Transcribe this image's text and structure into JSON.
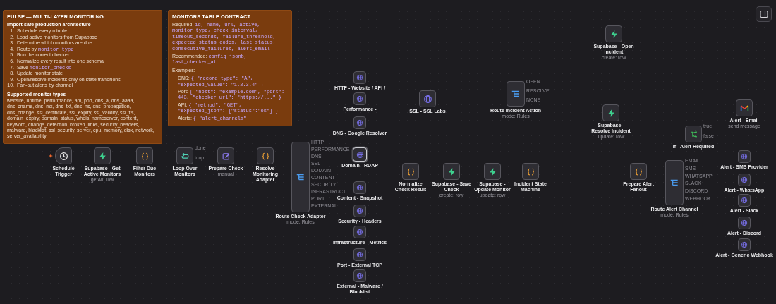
{
  "overview_note": {
    "title": "PULSE — MULTI-LAYER MONITORING",
    "subtitle": "Import-safe production architecture",
    "steps": [
      {
        "number": "1.",
        "text": "Schedule every minute"
      },
      {
        "number": "2.",
        "text": "Load active monitors from Supabase"
      },
      {
        "number": "3.",
        "text": "Determine which monitors are due"
      },
      {
        "number": "4.",
        "text": "Route by ",
        "code": "monitor_type"
      },
      {
        "number": "5.",
        "text": "Run the correct checker"
      },
      {
        "number": "6.",
        "text": "Normalize every result into one schema"
      },
      {
        "number": "7.",
        "text": "Save ",
        "code": "monitor_checks"
      },
      {
        "number": "8.",
        "text": "Update monitor state"
      },
      {
        "number": "9.",
        "text": "Open/resolve incidents only on state transitions"
      },
      {
        "number": "10.",
        "text": "Fan-out alerts by channel"
      }
    ],
    "section": "Supported monitor types",
    "body": "website, uptime, performance, api, port, dns_a, dns_aaaa, dns_cname, dns_mx, dns_txt, dns_ns, dns_propagation, dns_change, ssl_certificate, ssl_expiry, ssl_validity, ssl_tls, domain_expiry, domain_status, whois, nameserver, content, keyword, change_detection, broken_links, security_headers, malware, blacklist, ssl_security, server, cpu, memory, disk, network, server_availability"
  },
  "contract_note": {
    "title": "MONITORS.TABLE CONTRACT",
    "required_label": "Required:",
    "required": "id, name, url, active, monitor_type, check_interval, timeout_seconds, failure_threshold, expected_status_codes, last_status, consecutive_failures, alert_email",
    "recommended_label": "Recommended:",
    "recommended": "config jsonb, last_checked_at",
    "examples_label": "Examples:",
    "examples": [
      {
        "label": "DNS:",
        "code": "{ \"record_type\": \"A\", \"expected_value\": \"1.2.3.4\" }"
      },
      {
        "label": "Port:",
        "code": "{ \"host\": \"example.com\", \"port\": 443, \"checker_url\": \"https://...\" }"
      },
      {
        "label": "API:",
        "code": "{ \"method\": \"GET\", \"expected_json\": {\"status\":\"ok\"} }"
      },
      {
        "label": "Alerts:",
        "code": "{ \"alert_channels\":"
      }
    ]
  },
  "nodes": [
    {
      "name": "Schedule Trigger",
      "kind": "trigger",
      "selected": false
    },
    {
      "name": "Supabase - Get Active Monitors",
      "kind": "supabase",
      "subtitle": "getAll: row",
      "selected": false
    },
    {
      "name": "Filter Due Monitors",
      "kind": "code",
      "selected": false
    },
    {
      "name": "Loop Over Monitors",
      "kind": "loop",
      "outputs": [
        "done",
        "loop"
      ],
      "selected": false
    },
    {
      "name": "Prepare Check",
      "kind": "set",
      "subtitle": "manual",
      "selected": false
    },
    {
      "name": "Resolve Monitoring Adapter",
      "kind": "code",
      "selected": false
    },
    {
      "name": "Route Check Adapter",
      "kind": "switch",
      "subtitle": "mode: Rules",
      "outputs": [
        "HTTP",
        "PERFORMANCE",
        "DNS",
        "SSL",
        "DOMAIN",
        "CONTENT",
        "SECURITY",
        "INFRASTRUCT...",
        "PORT",
        "EXTERNAL"
      ],
      "selected": false
    },
    {
      "name": "HTTP - Website / API /",
      "kind": "http",
      "selected": false
    },
    {
      "name": "Performance -",
      "kind": "http",
      "selected": false
    },
    {
      "name": "DNS - Google Resolver",
      "kind": "http",
      "selected": false
    },
    {
      "name": "Domain - RDAP",
      "kind": "http",
      "selected": true
    },
    {
      "name": "Content - Snapshot",
      "kind": "http",
      "selected": false
    },
    {
      "name": "Security - Headers",
      "kind": "http",
      "selected": false
    },
    {
      "name": "Infrastructure - Metrics",
      "kind": "http",
      "selected": false
    },
    {
      "name": "Port - External TCP",
      "kind": "http",
      "selected": false
    },
    {
      "name": "External - Malware / Blacklist",
      "kind": "http",
      "selected": false
    },
    {
      "name": "SSL - SSL Labs",
      "kind": "http",
      "selected": false
    },
    {
      "name": "Route Incident Action",
      "kind": "switch",
      "subtitle": "mode: Rules",
      "outputs": [
        "OPEN",
        "RESOLVE",
        "NONE"
      ],
      "selected": false
    },
    {
      "name": "Normalize Check Result",
      "kind": "code",
      "selected": false
    },
    {
      "name": "Supabase - Save Check",
      "kind": "supabase",
      "subtitle": "create: row",
      "selected": false
    },
    {
      "name": "Supabase - Update Monitor",
      "kind": "supabase",
      "subtitle": "update: row",
      "selected": false
    },
    {
      "name": "Incident State Machine",
      "kind": "code",
      "selected": false
    },
    {
      "name": "Supabase - Open Incident",
      "kind": "supabase",
      "subtitle": "create: row",
      "selected": false
    },
    {
      "name": "Supabase - Resolve Incident",
      "kind": "supabase",
      "subtitle": "update: row",
      "selected": false
    },
    {
      "name": "Prepare Alert Fanout",
      "kind": "code",
      "selected": false
    },
    {
      "name": "If - Alert Required",
      "kind": "if",
      "outputs": [
        "true",
        "false"
      ],
      "selected": false
    },
    {
      "name": "Route Alert Channel",
      "kind": "switch",
      "subtitle": "mode: Rules",
      "outputs": [
        "EMAIL",
        "SMS",
        "WHATSAPP",
        "SLACK",
        "DISCORD",
        "WEBHOOK"
      ],
      "selected": false
    },
    {
      "name": "Alert - Email",
      "kind": "gmail",
      "subtitle": "send message",
      "selected": false
    },
    {
      "name": "Alert - SMS Provider",
      "kind": "http",
      "selected": false
    },
    {
      "name": "Alert - WhatsApp",
      "kind": "http",
      "selected": false
    },
    {
      "name": "Alert - Slack",
      "kind": "http",
      "selected": false
    },
    {
      "name": "Alert - Discord",
      "kind": "http",
      "selected": false
    },
    {
      "name": "Alert - Generic Webhook",
      "kind": "http",
      "selected": false
    }
  ]
}
